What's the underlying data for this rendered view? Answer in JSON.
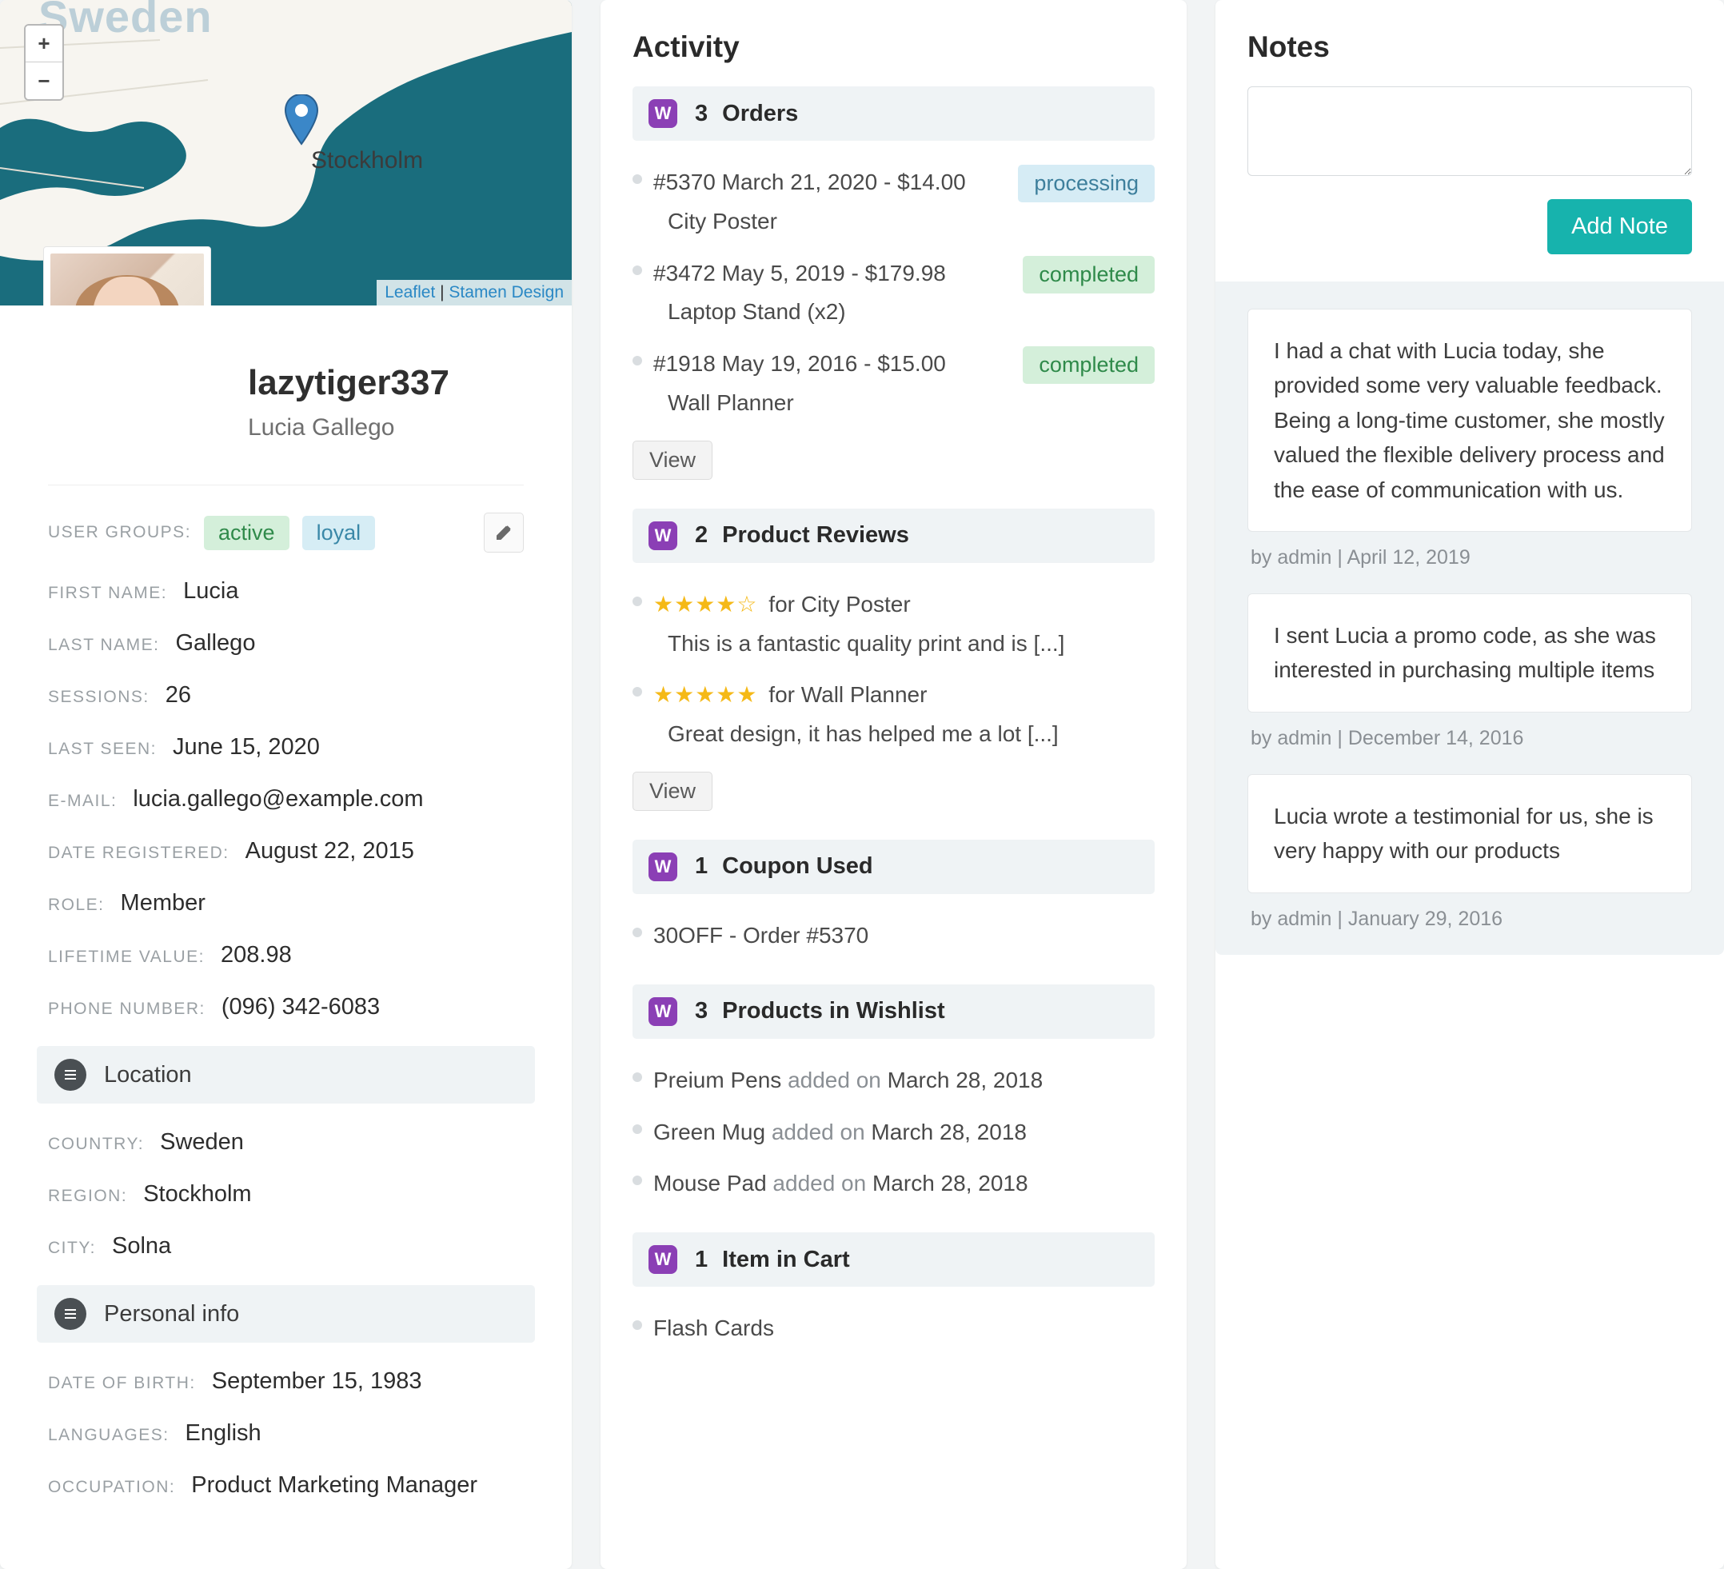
{
  "map": {
    "country_label": "Sweden",
    "city_label": "Stockholm",
    "attrib_leaflet": "Leaflet",
    "attrib_stamen": "Stamen Design",
    "zoom_in": "+",
    "zoom_out": "−"
  },
  "profile": {
    "username": "lazytiger337",
    "fullname": "Lucia Gallego",
    "groups": {
      "label": "USER GROUPS:",
      "active": "active",
      "loyal": "loyal"
    },
    "fields": {
      "first_name": {
        "lbl": "FIRST NAME:",
        "val": "Lucia"
      },
      "last_name": {
        "lbl": "LAST NAME:",
        "val": "Gallego"
      },
      "sessions": {
        "lbl": "SESSIONS:",
        "val": "26"
      },
      "last_seen": {
        "lbl": "LAST SEEN:",
        "val": "June 15, 2020"
      },
      "email": {
        "lbl": "E-MAIL:",
        "val": "lucia.gallego@example.com"
      },
      "registered": {
        "lbl": "DATE REGISTERED:",
        "val": "August 22, 2015"
      },
      "role": {
        "lbl": "ROLE:",
        "val": "Member"
      },
      "ltv": {
        "lbl": "LIFETIME VALUE:",
        "val": "208.98"
      },
      "phone": {
        "lbl": "PHONE NUMBER:",
        "val": "(096) 342-6083"
      }
    },
    "location_header": "Location",
    "location": {
      "country": {
        "lbl": "COUNTRY:",
        "val": "Sweden"
      },
      "region": {
        "lbl": "REGION:",
        "val": "Stockholm"
      },
      "city": {
        "lbl": "CITY:",
        "val": "Solna"
      }
    },
    "personal_header": "Personal info",
    "personal": {
      "dob": {
        "lbl": "DATE OF BIRTH:",
        "val": "September 15, 1983"
      },
      "languages": {
        "lbl": "LANGUAGES:",
        "val": "English"
      },
      "occupation": {
        "lbl": "OCCUPATION:",
        "val": "Product Marketing Manager"
      }
    }
  },
  "activity": {
    "title": "Activity",
    "orders": {
      "count": "3",
      "label": "Orders",
      "items": [
        {
          "line1": "#5370 March 21, 2020 - $14.00",
          "line2": "City Poster",
          "status": "processing"
        },
        {
          "line1": "#3472 May 5, 2019 - $179.98",
          "line2": "Laptop Stand (x2)",
          "status": "completed"
        },
        {
          "line1": "#1918 May 19, 2016 - $15.00",
          "line2": "Wall Planner",
          "status": "completed"
        }
      ],
      "view": "View"
    },
    "reviews": {
      "count": "2",
      "label": "Product Reviews",
      "items": [
        {
          "stars": 4,
          "for": "for City Poster",
          "text": "This is a fantastic quality print and is [...]"
        },
        {
          "stars": 5,
          "for": "for Wall Planner",
          "text": "Great design, it has helped me a lot [...]"
        }
      ],
      "view": "View"
    },
    "coupon": {
      "count": "1",
      "label": "Coupon Used",
      "text": "30OFF - Order #5370"
    },
    "wishlist": {
      "count": "3",
      "label": "Products in Wishlist",
      "items": [
        {
          "name": "Preium Pens",
          "mid": " added on ",
          "date": "March 28, 2018"
        },
        {
          "name": "Green Mug",
          "mid": " added on ",
          "date": "March 28, 2018"
        },
        {
          "name": "Mouse Pad",
          "mid": " added on ",
          "date": "March 28, 2018"
        }
      ]
    },
    "cart": {
      "count": "1",
      "label": "Item in Cart",
      "text": "Flash Cards"
    }
  },
  "notes": {
    "title": "Notes",
    "add_button": "Add Note",
    "items": [
      {
        "text": "I had a chat with Lucia today, she provided some very valuable feedback. Being a long-time customer, she mostly valued the flexible delivery process and the ease of communication with us.",
        "meta": "by admin | April 12, 2019"
      },
      {
        "text": "I sent Lucia a promo code, as she was interested in purchasing multiple items",
        "meta": "by admin | December 14, 2016"
      },
      {
        "text": "Lucia wrote a testimonial for us, she is very happy with our products",
        "meta": "by admin | January 29, 2016"
      }
    ]
  }
}
